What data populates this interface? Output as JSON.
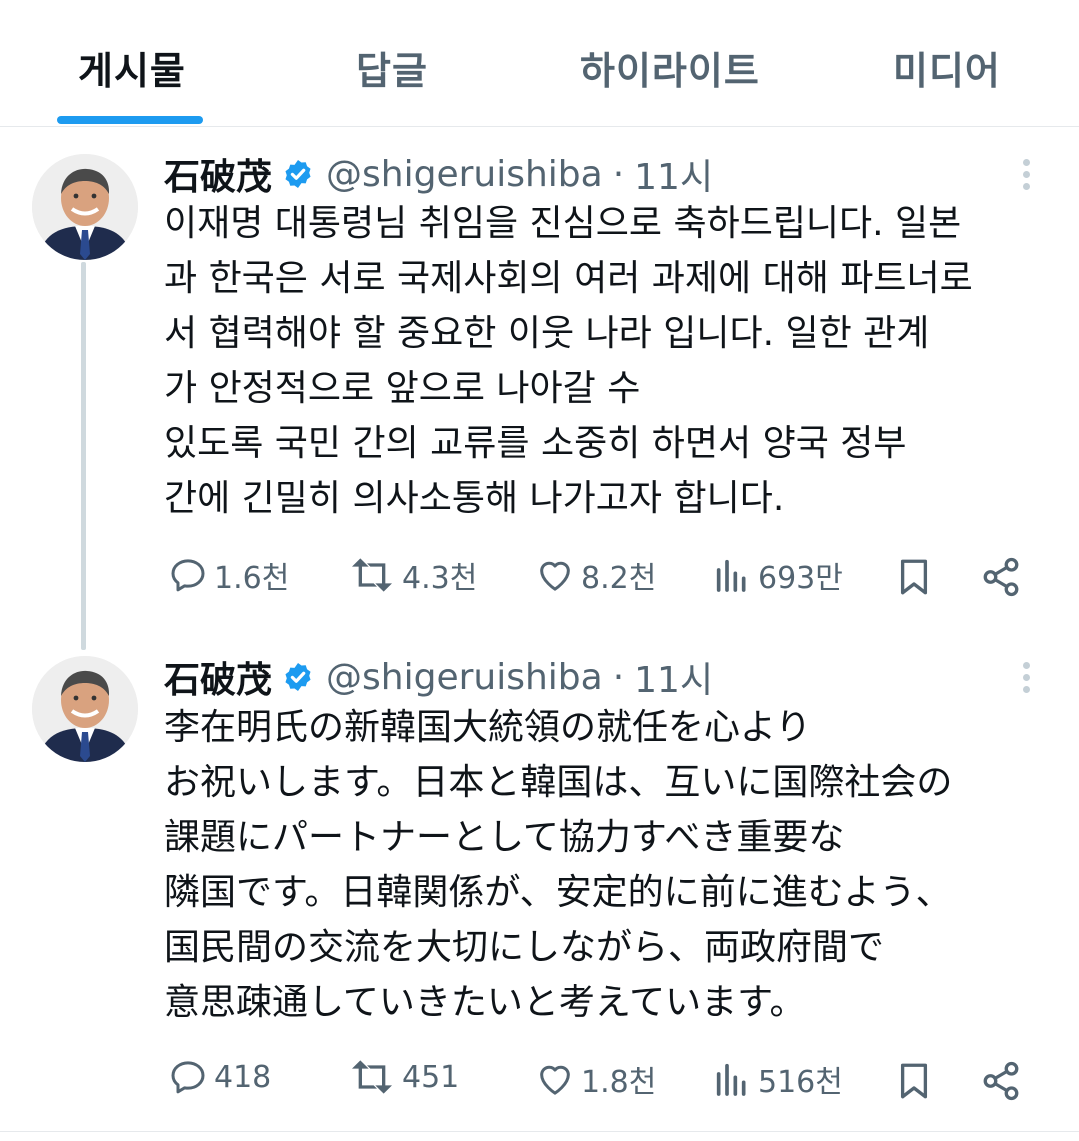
{
  "tabs": [
    {
      "label": "게시물",
      "active": true
    },
    {
      "label": "답글",
      "active": false
    },
    {
      "label": "하이라이트",
      "active": false
    },
    {
      "label": "미디어",
      "active": false
    }
  ],
  "posts": [
    {
      "author": {
        "name": "石破茂",
        "handle": "@shigeruishiba",
        "verified": true
      },
      "dot": "·",
      "time": "11시",
      "text": "이재명 대통령님 취임을 진심으로 축하드립니다. 일본\n과 한국은 서로 국제사회의 여러 과제에 대해 파트너로\n서 협력해야 할 중요한 이웃 나라 입니다. 일한 관계\n가 안정적으로 앞으로 나아갈 수\n있도록 국민 간의 교류를 소중히 하면서 양국 정부\n간에 긴밀히 의사소통해 나가고자 합니다.",
      "stats": {
        "replies": "1.6천",
        "reposts": "4.3천",
        "likes": "8.2천",
        "views": "693만"
      }
    },
    {
      "author": {
        "name": "石破茂",
        "handle": "@shigeruishiba",
        "verified": true
      },
      "dot": "·",
      "time": "11시",
      "text": "李在明氏の新韓国大統領の就任を心より\nお祝いします。日本と韓国は、互いに国際社会の\n課題にパートナーとして協力すべき重要な\n隣国です。日韓関係が、安定的に前に進むよう、\n国民間の交流を大切にしながら、両政府間で\n意思疎通していきたいと考えています。",
      "stats": {
        "replies": "418",
        "reposts": "451",
        "likes": "1.8천",
        "views": "516천"
      }
    }
  ],
  "icons": {
    "verified": "verified-badge-icon",
    "reply": "reply-icon",
    "repost": "repost-icon",
    "like": "heart-icon",
    "views": "views-icon",
    "bookmark": "bookmark-icon",
    "share": "share-icon",
    "more": "more-icon"
  },
  "colors": {
    "accent": "#1d9bf0",
    "secondary_text": "#536471",
    "text": "#0f1419",
    "divider": "#e6e9ec"
  }
}
